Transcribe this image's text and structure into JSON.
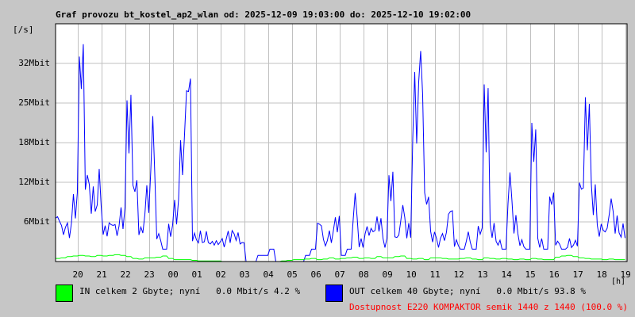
{
  "chart_data": {
    "type": "line",
    "title": "Graf provozu bt_kostel_ap2_wlan od: 2025-12-09 19:03:00 do: 2025-12-10 19:02:00",
    "ylabel": "[/s]",
    "xlabel": "[h]",
    "ylim": [
      0,
      38.4
    ],
    "yticks": [
      {
        "v": 6.4,
        "label": "6Mbit"
      },
      {
        "v": 12.8,
        "label": "12Mbit"
      },
      {
        "v": 19.2,
        "label": "18Mbit"
      },
      {
        "v": 25.6,
        "label": "25Mbit"
      },
      {
        "v": 32,
        "label": "32Mbit"
      }
    ],
    "xticks": [
      "20",
      "21",
      "22",
      "23",
      "00",
      "01",
      "02",
      "03",
      "04",
      "05",
      "06",
      "07",
      "08",
      "09",
      "10",
      "11",
      "12",
      "13",
      "14",
      "15",
      "16",
      "17",
      "18",
      "19"
    ],
    "x_start_hour": 19.05,
    "x_step_hours": 0.25,
    "series": [
      {
        "name": "IN",
        "color": "#00ff00",
        "values": [
          0.5,
          0.6,
          0.8,
          0.9,
          1,
          0.9,
          0.8,
          1,
          0.9,
          1,
          1.1,
          1,
          0.8,
          0.5,
          0.4,
          0.6,
          0.6,
          0.7,
          0.9,
          0.5,
          0.3,
          0.3,
          0.3,
          0.2,
          0.1,
          0.1,
          0.1,
          0.1,
          0,
          0,
          0,
          0,
          0,
          0,
          0,
          0,
          0,
          0,
          0.1,
          0.2,
          0.3,
          0.3,
          0.4,
          0.5,
          0.3,
          0.4,
          0.6,
          0.4,
          0.5,
          0.6,
          0.7,
          0.5,
          0.6,
          0.5,
          0.8,
          0.6,
          0.6,
          0.8,
          0.9,
          0.5,
          0.4,
          0.5,
          0.3,
          0.6,
          0.6,
          0.5,
          0.4,
          0.4,
          0.5,
          0.6,
          0.4,
          0.3,
          0.6,
          0.5,
          0.4,
          0.5,
          0.4,
          0.3,
          0.4,
          0.3,
          0.5,
          0.4,
          0.3,
          0.3,
          0.7,
          0.9,
          1,
          0.8,
          0.6,
          0.5,
          0.4,
          0.4,
          0.3,
          0.4,
          0.3,
          0.3
        ]
      },
      {
        "name": "OUT",
        "color": "#0000ff",
        "values": [
          7,
          5,
          5,
          9,
          31,
          13,
          10,
          12,
          5,
          6,
          5,
          7,
          22,
          12,
          5,
          10,
          19,
          4,
          2,
          5,
          8,
          17,
          28,
          4,
          4,
          4,
          3,
          3,
          3,
          4,
          4,
          3,
          0,
          0,
          1,
          1,
          2,
          0,
          0,
          0,
          0,
          0,
          1,
          2,
          6,
          3,
          4,
          6,
          1,
          2,
          9,
          3,
          5,
          5,
          6,
          3,
          12,
          4,
          8,
          5,
          25,
          31,
          10,
          4,
          3,
          4,
          8,
          3,
          2,
          4,
          2,
          5,
          23,
          5,
          3,
          2,
          12,
          6,
          3,
          2,
          19,
          3,
          2,
          10,
          3,
          2,
          3,
          3,
          12,
          22,
          10,
          5,
          5,
          9,
          6,
          5
        ]
      }
    ]
  },
  "legend": [
    {
      "color": "#00ff00",
      "text": "IN celkem 2 Gbyte; nyní   0.0 Mbit/s 4.2 %"
    },
    {
      "color": "#0000ff",
      "text": "OUT celkem 40 Gbyte; nyní   0.0 Mbit/s 93.8 %"
    }
  ],
  "availability": "Dostupnost E220 KOMPAKTOR semik 1440 z 1440 (100.0 %)",
  "availability_color": "#ff0000"
}
